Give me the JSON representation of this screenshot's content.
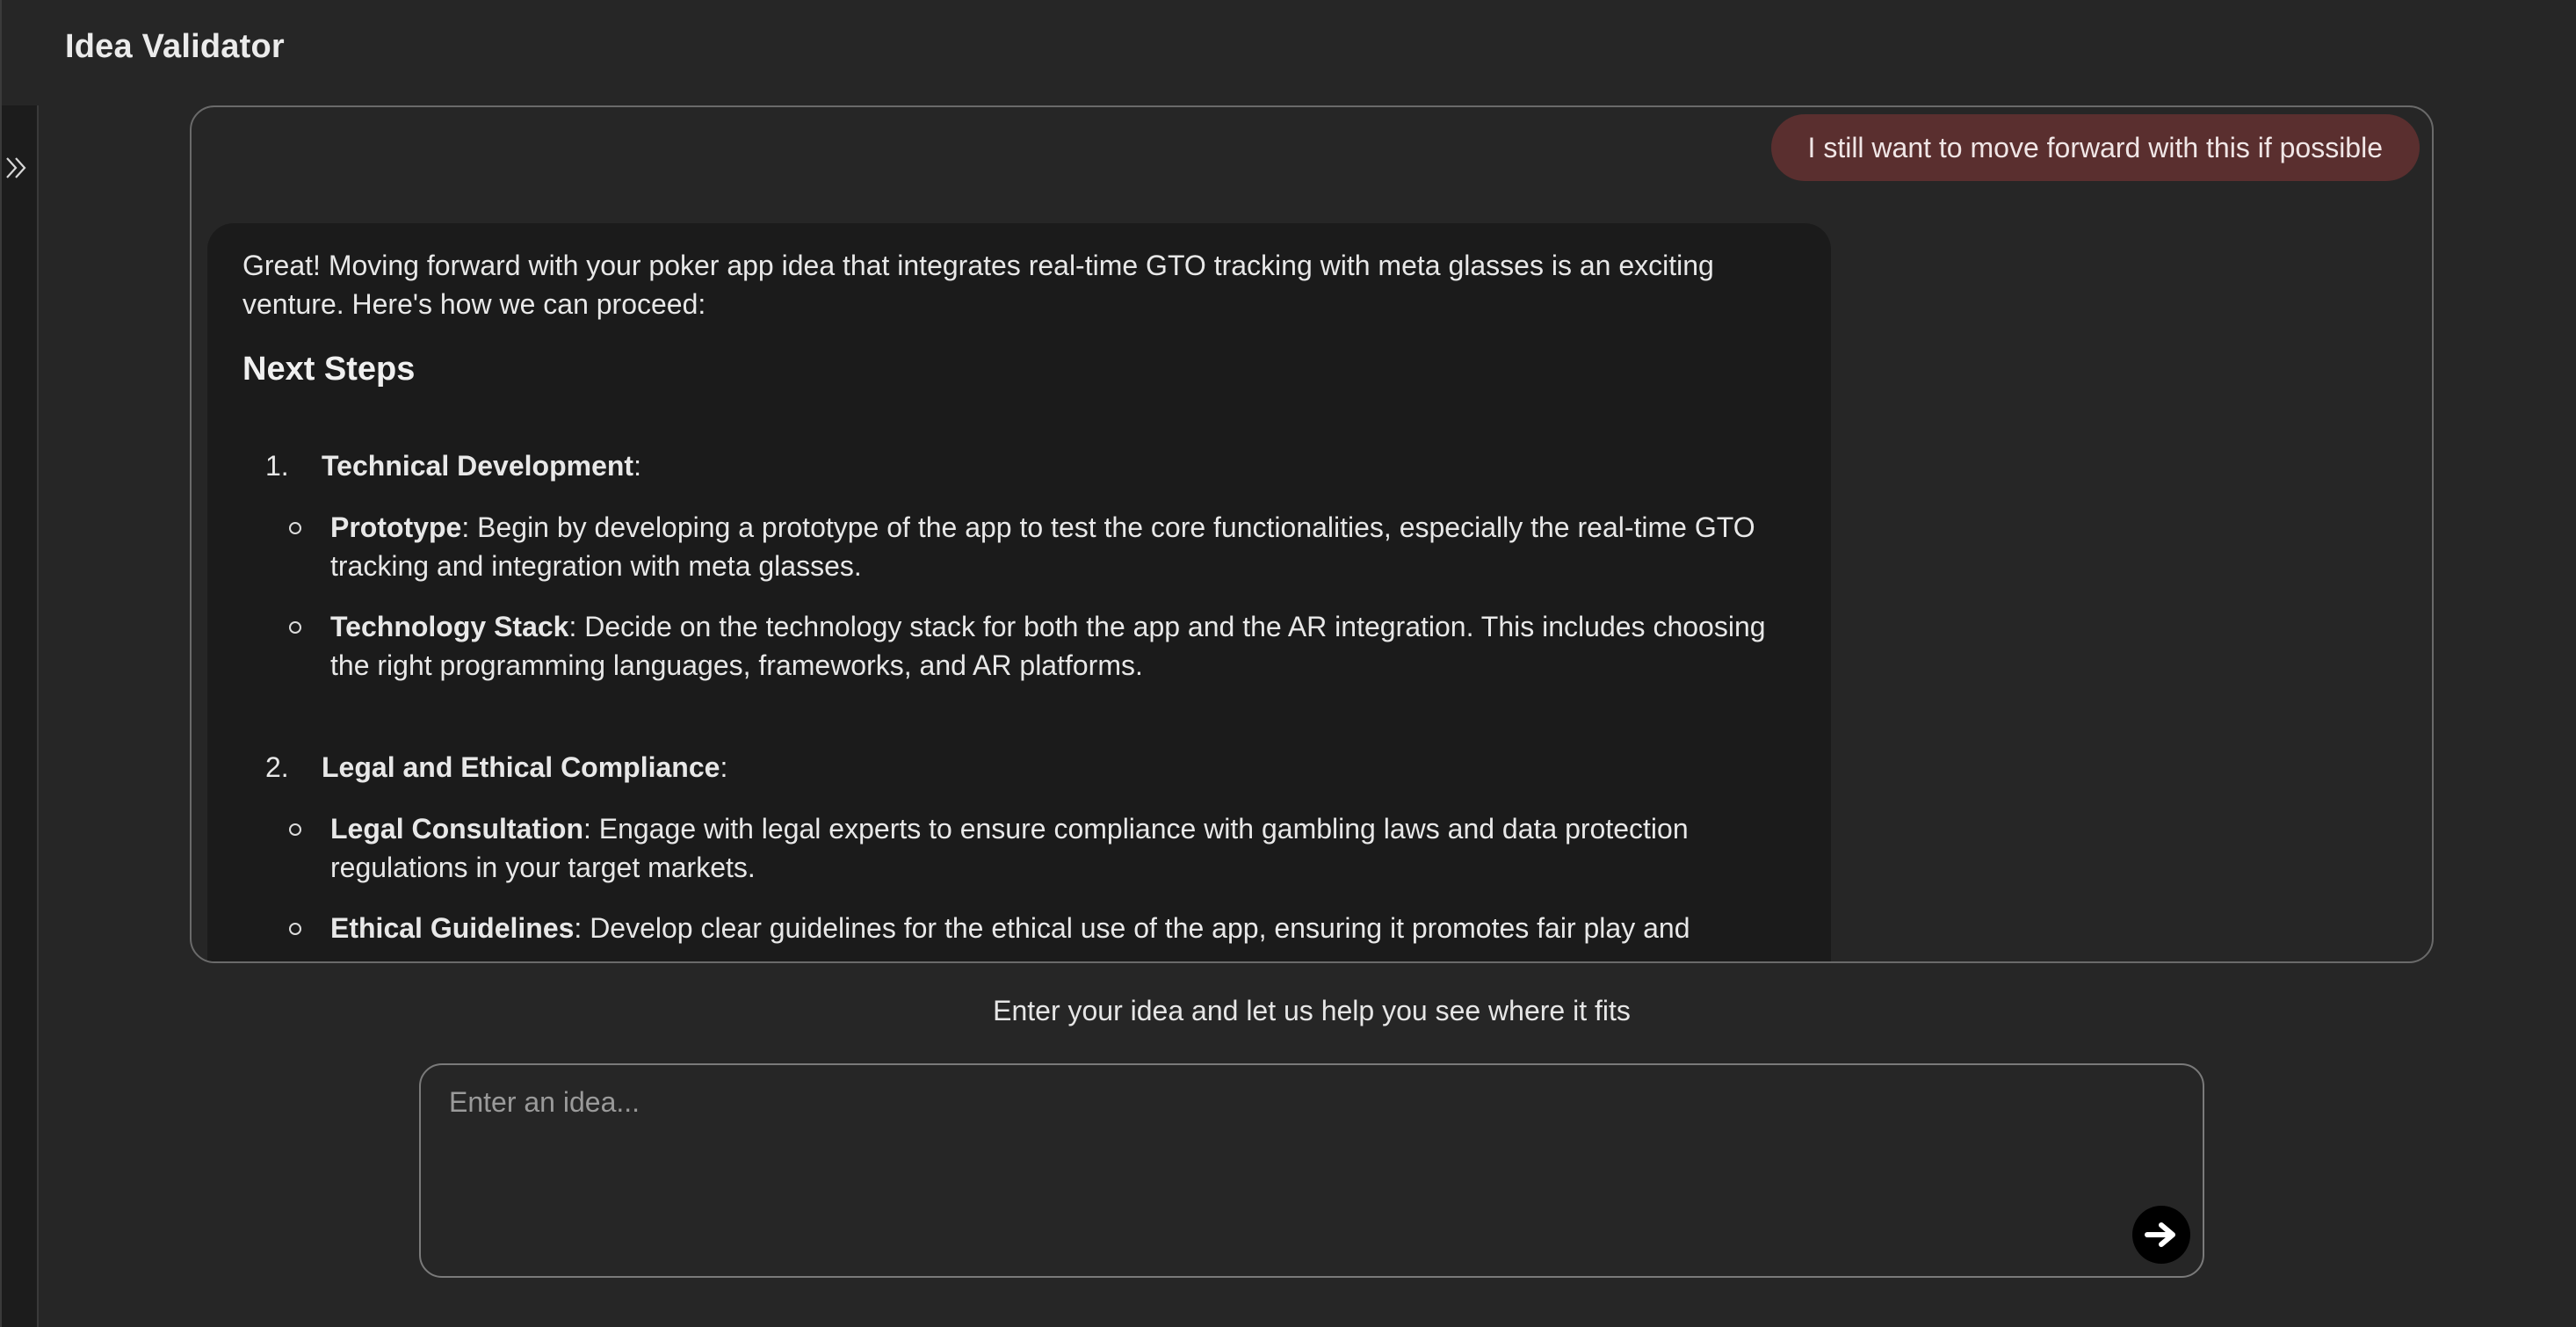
{
  "app": {
    "title": "Idea Validator"
  },
  "chat": {
    "user_message": "I still want to move forward with this if possible",
    "assistant": {
      "intro": "Great! Moving forward with your poker app idea that integrates real-time GTO tracking with meta glasses is an exciting venture. Here's how we can proceed:",
      "heading": "Next Steps",
      "steps": [
        {
          "number": "1.",
          "title": "Technical Development",
          "suffix": ":",
          "items": [
            {
              "label": "Prototype",
              "text": ": Begin by developing a prototype of the app to test the core functionalities, especially the real-time GTO tracking and integration with meta glasses."
            },
            {
              "label": "Technology Stack",
              "text": ": Decide on the technology stack for both the app and the AR integration. This includes choosing the right programming languages, frameworks, and AR platforms."
            }
          ]
        },
        {
          "number": "2.",
          "title": "Legal and Ethical Compliance",
          "suffix": ":",
          "items": [
            {
              "label": "Legal Consultation",
              "text": ": Engage with legal experts to ensure compliance with gambling laws and data protection regulations in your target markets."
            },
            {
              "label": "Ethical Guidelines",
              "text": ": Develop clear guidelines for the ethical use of the app, ensuring it promotes fair play and"
            }
          ]
        }
      ]
    }
  },
  "composer": {
    "prompt": "Enter your idea and let us help you see where it fits",
    "placeholder": "Enter an idea...",
    "value": ""
  },
  "icons": {
    "sidebar_toggle": "double-chevron-right-icon",
    "submit": "arrow-right-icon"
  },
  "colors": {
    "background": "#262626",
    "user_bubble": "#5a2f2f",
    "assistant_bubble": "#1b1b1b",
    "submit_button": "#000000"
  }
}
